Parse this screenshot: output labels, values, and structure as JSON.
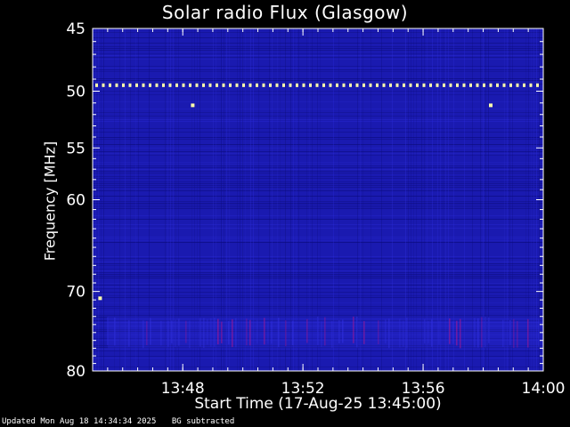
{
  "chart_data": {
    "type": "heatmap",
    "title": "Solar radio Flux (Glasgow)",
    "xlabel": "Start Time (17-Aug-25 13:45:00)",
    "ylabel": "Frequency [MHz]",
    "x_unit": "time",
    "xlim": [
      "13:45:00",
      "14:00:00"
    ],
    "xticks": [
      "13:48",
      "13:52",
      "13:56",
      "14:00"
    ],
    "ylim": [
      45,
      80
    ],
    "yscale": "log",
    "y_inverted": true,
    "yticks": [
      45,
      50,
      55,
      60,
      70,
      80
    ],
    "grid": false,
    "colors": {
      "background": "#000000",
      "spectrum_base": "#1a1ab0",
      "spectrum_dark": "#0b0b78",
      "spectrum_light": "#3030e0",
      "interference": "#ffffaa",
      "burst": "#b01890",
      "axes": "#ffffff"
    },
    "features": [
      {
        "kind": "persistent_interference_line",
        "frequency": 49.5,
        "time_range": [
          "13:45:00",
          "14:00:00"
        ]
      },
      {
        "kind": "interference_spot",
        "frequency": 51.2,
        "time": "13:48:20"
      },
      {
        "kind": "interference_spot",
        "frequency": 51.2,
        "time": "13:58:15"
      },
      {
        "kind": "interference_spot",
        "frequency": 70.8,
        "time": "13:45:15"
      },
      {
        "kind": "broadband_band",
        "frequency_range": [
          73,
          77
        ],
        "time_range": [
          "13:45:30",
          "14:00:00"
        ]
      }
    ]
  },
  "footer": {
    "updated": "Updated Mon Aug 18 14:34:34 2025",
    "note": "BG subtracted"
  }
}
